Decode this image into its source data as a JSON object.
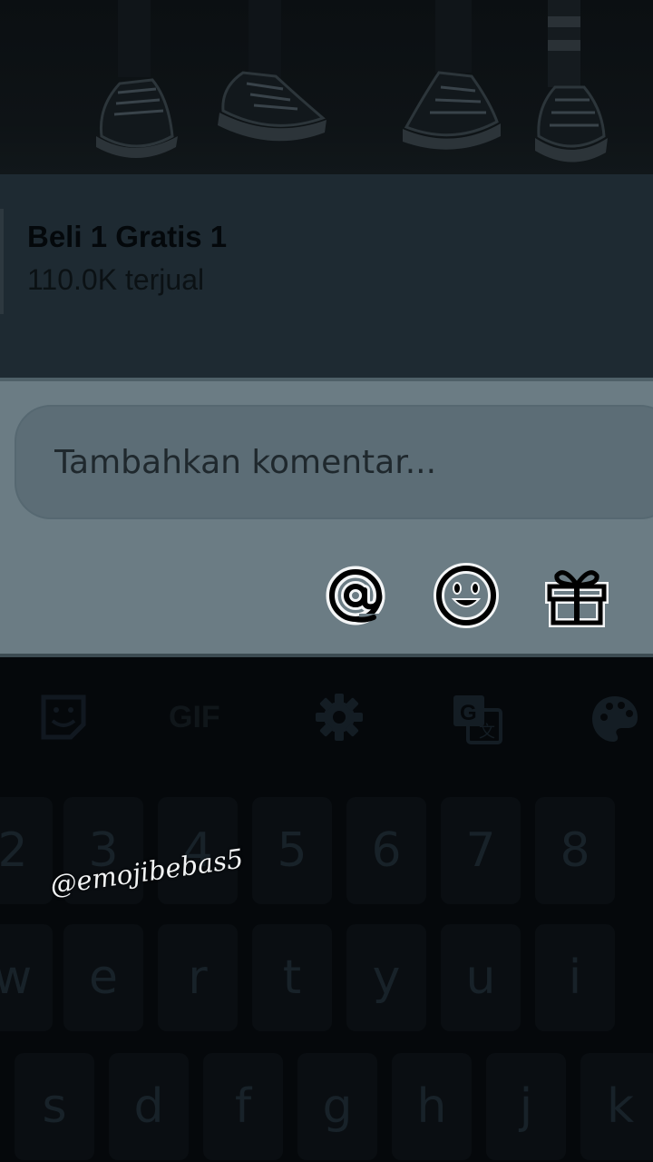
{
  "product": {
    "promo_title": "Beli 1 Gratis 1",
    "sold_count": "110.0K terjual"
  },
  "comment": {
    "placeholder": "Tambahkan komentar...",
    "icons": [
      "mention-icon",
      "emoji-icon",
      "gift-icon"
    ]
  },
  "keyboard": {
    "toolbar": {
      "sticker_icon": "sticker-icon",
      "gif_label": "GIF",
      "settings_icon": "gear-icon",
      "translate_icon": "translate-icon",
      "theme_icon": "palette-icon"
    },
    "rows": [
      [
        "2",
        "3",
        "4",
        "5",
        "6",
        "7",
        "8"
      ],
      [
        "w",
        "e",
        "r",
        "t",
        "y",
        "u",
        "i"
      ],
      [
        "s",
        "d",
        "f",
        "g",
        "h",
        "j",
        "k"
      ]
    ]
  },
  "watermark": "@emojibebas5",
  "colors": {
    "overlay": "#05080b",
    "banner": "#1e2a32",
    "panel": "#6b7c84",
    "input": "#5c6d76"
  }
}
